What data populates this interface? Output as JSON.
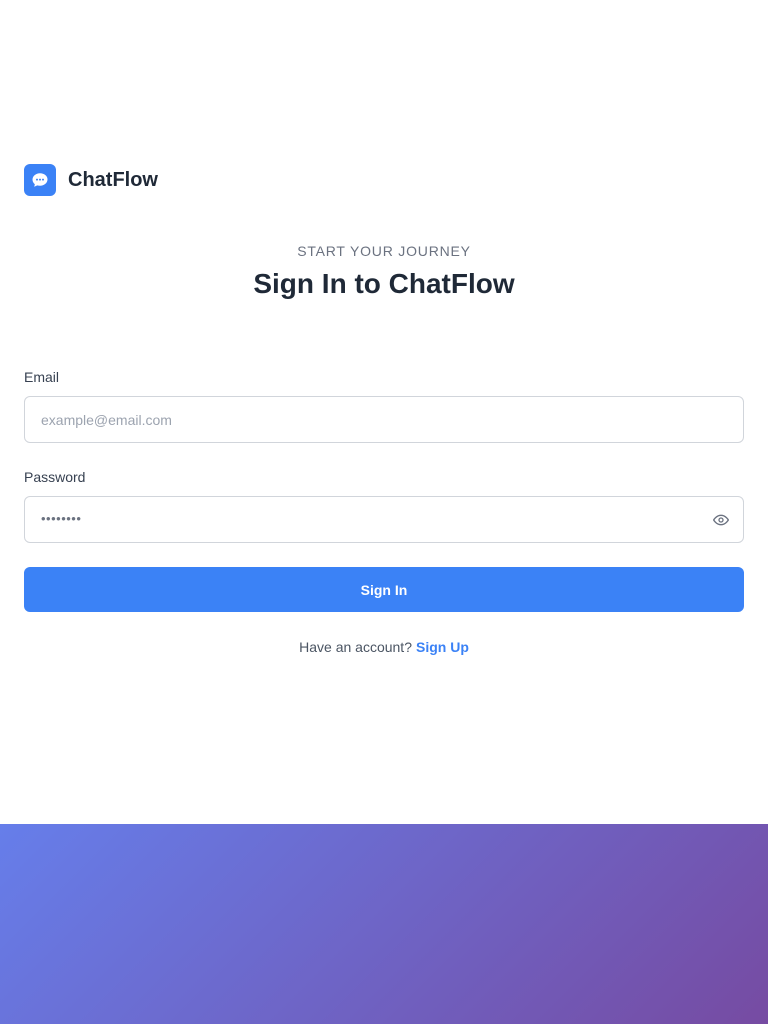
{
  "brand": {
    "name": "ChatFlow",
    "logo_icon": "chat-bubble-icon",
    "accent_color": "#3b82f6"
  },
  "header": {
    "eyebrow": "START YOUR JOURNEY",
    "title": "Sign In to ChatFlow"
  },
  "form": {
    "email": {
      "label": "Email",
      "placeholder": "example@email.com",
      "value": ""
    },
    "password": {
      "label": "Password",
      "masked_value": "••••••••",
      "toggle_icon": "eye-icon"
    },
    "submit_label": "Sign In"
  },
  "footer": {
    "prompt": "Have an account?",
    "link_label": "Sign Up"
  },
  "background": {
    "gradient_start": "#667eea",
    "gradient_end": "#764ba2"
  }
}
